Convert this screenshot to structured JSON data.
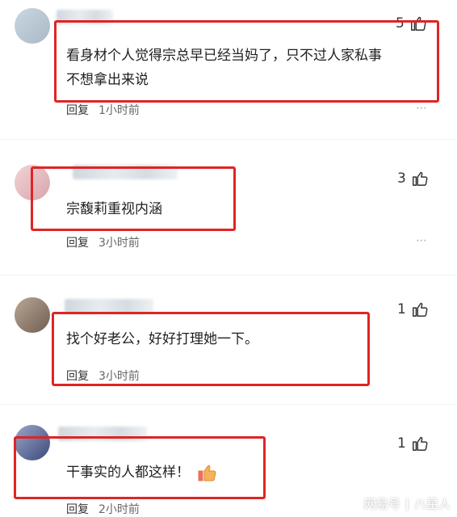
{
  "comments": [
    {
      "likes": "5",
      "text_lines": [
        "看身材个人觉得宗总早已经当妈了，只不过人家私事",
        "不想拿出来说"
      ],
      "reply_label": "回复",
      "time": "1小时前"
    },
    {
      "likes": "3",
      "text_lines": [
        "宗馥莉重视内涵"
      ],
      "reply_label": "回复",
      "time": "3小时前"
    },
    {
      "likes": "1",
      "text_lines": [
        "找个好老公，好好打理她一下。"
      ],
      "reply_label": "回复",
      "time": "3小时前"
    },
    {
      "likes": "1",
      "text_lines": [
        "干事实的人都这样！"
      ],
      "reply_label": "回复",
      "time": "2小时前"
    }
  ],
  "footer": {
    "brand": "网易号",
    "separator": "|",
    "author": "八星人"
  },
  "colors": {
    "highlight_border": "#e02424",
    "meta_text": "#666666"
  }
}
